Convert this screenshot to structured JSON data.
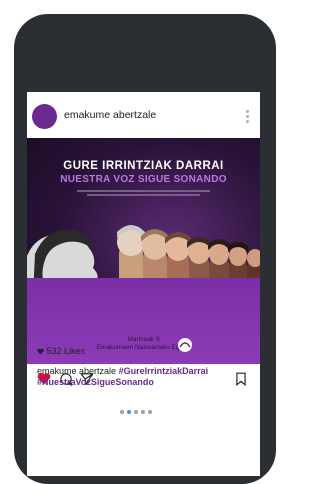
{
  "post": {
    "username": "emakume abertzale",
    "image_title": "GURE IRRINTZIAK DARRAI",
    "image_subtitle": "NUESTRA VOZ SIGUE SONANDO",
    "image_bottom_line1": "Martxoak 8",
    "image_bottom_line2": "Emakumeen Nazioarteko Eguna",
    "likes": "532 Likes",
    "caption_user": "emakume abertzale",
    "hashtag_1": "#GureIrrintziakDarrai",
    "hashtag_2": "#NuestraVozSigueSonando"
  },
  "carousel": {
    "dot_count": 5,
    "active_index": 1
  },
  "colors": {
    "phone_frame": "#2b2e33",
    "accent_purple": "#6c2a8e",
    "like_red": "#d0103a",
    "active_dot": "#2f9bd6"
  },
  "icons": [
    "more-dots-icon",
    "heart-icon",
    "comment-icon",
    "send-icon",
    "bookmark-icon",
    "small-heart-icon"
  ]
}
